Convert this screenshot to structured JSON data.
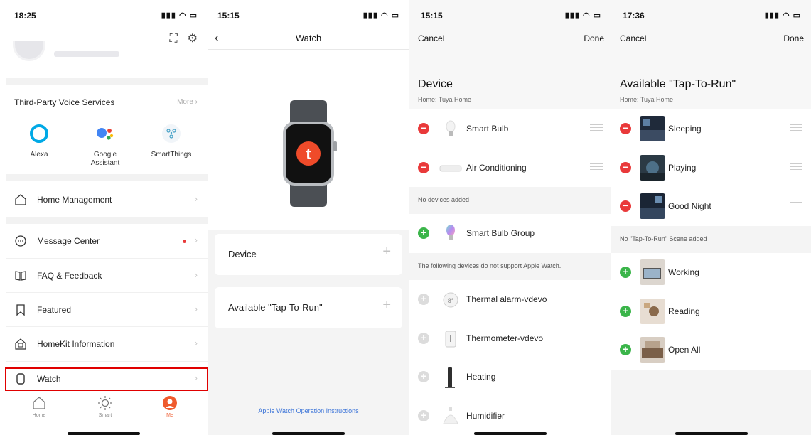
{
  "panel_me": {
    "status_time": "18:25",
    "voice_services_title": "Third-Party Voice Services",
    "more_label": "More",
    "voice_services": [
      {
        "label": "Alexa",
        "icon": "alexa-icon"
      },
      {
        "label": "Google\nAssistant",
        "icon": "google-assistant-icon"
      },
      {
        "label": "SmartThings",
        "icon": "smartthings-icon"
      }
    ],
    "menu": [
      {
        "label": "Home Management",
        "icon": "home-icon"
      },
      {
        "label": "Message Center",
        "icon": "message-icon"
      },
      {
        "label": "FAQ & Feedback",
        "icon": "book-icon"
      },
      {
        "label": "Featured",
        "icon": "bookmark-icon"
      },
      {
        "label": "HomeKit Information",
        "icon": "homekit-icon"
      },
      {
        "label": "Watch",
        "icon": "watch-icon"
      }
    ],
    "tabs": [
      {
        "label": "Home",
        "icon": "home-tab-icon"
      },
      {
        "label": "Smart",
        "icon": "sun-icon"
      },
      {
        "label": "Me",
        "icon": "me-icon"
      }
    ],
    "accent": "#ef5a2d",
    "highlight_color": "#e00000"
  },
  "panel_watch": {
    "status_time": "15:15",
    "title": "Watch",
    "cards": [
      {
        "label": "Device"
      },
      {
        "label": "Available \"Tap-To-Run\""
      }
    ],
    "instructions_link": "Apple Watch Operation Instructions",
    "link_color": "#3a73d8"
  },
  "panel_device": {
    "status_time": "15:15",
    "cancel": "Cancel",
    "done": "Done",
    "heading": "Device",
    "home_line": "Home:  Tuya Home",
    "added": [
      {
        "label": "Smart Bulb",
        "icon": "bulb-icon"
      },
      {
        "label": "Air Conditioning",
        "icon": "air-conditioner-icon"
      }
    ],
    "no_devices_text": "No devices added",
    "available": [
      {
        "label": "Smart Bulb Group",
        "icon": "bulb-group-icon"
      }
    ],
    "unsupported_text": "The following devices do not support Apple Watch.",
    "unsupported": [
      {
        "label": "Thermal alarm-vdevo",
        "icon": "thermal-alarm-icon"
      },
      {
        "label": "Thermometer-vdevo",
        "icon": "thermometer-icon"
      },
      {
        "label": "Heating",
        "icon": "heater-icon"
      },
      {
        "label": "Humidifier",
        "icon": "humidifier-icon"
      }
    ]
  },
  "panel_scenes": {
    "status_time": "17:36",
    "cancel": "Cancel",
    "done": "Done",
    "heading": "Available \"Tap-To-Run\"",
    "home_line": "Home:  Tuya Home",
    "added": [
      {
        "label": "Sleeping"
      },
      {
        "label": "Playing"
      },
      {
        "label": "Good Night"
      }
    ],
    "no_scene_text": "No \"Tap-To-Run\" Scene added",
    "available": [
      {
        "label": "Working"
      },
      {
        "label": "Reading"
      },
      {
        "label": "Open All"
      }
    ]
  }
}
